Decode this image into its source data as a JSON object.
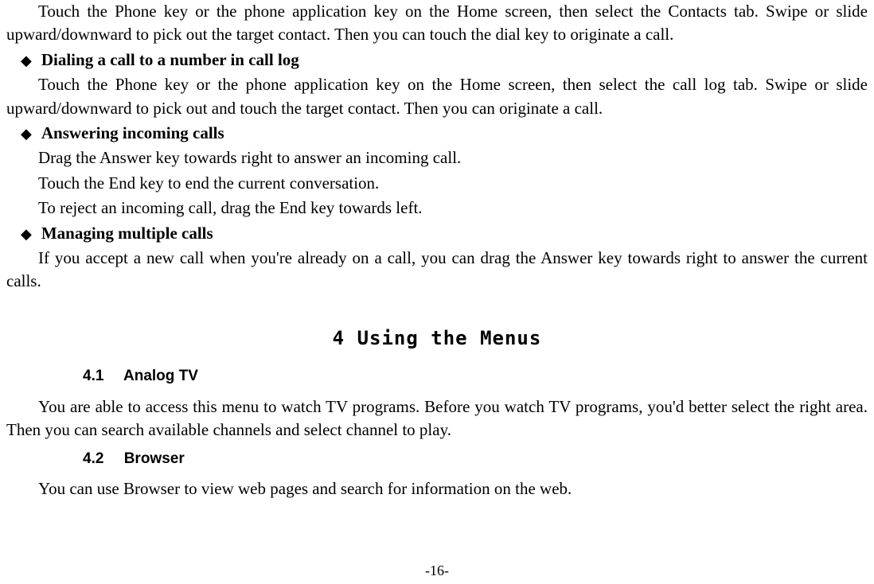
{
  "p1": "Touch the Phone key or the phone application key on the Home screen, then select the Contacts tab. Swipe or slide upward/downward to pick out the target contact. Then you can touch the dial key to originate a call.",
  "bullet1": "Dialing a call to a number in call log",
  "p2": "Touch the Phone key or the phone application key on the Home screen, then select the call log tab. Swipe or slide upward/downward to pick out and touch the target contact. Then you can originate a call.",
  "bullet2": "Answering incoming calls",
  "p3": "Drag the Answer key towards right to answer an incoming call.",
  "p4": "Touch the End key to end the current conversation.",
  "p5": "To reject an incoming call, drag the End key towards left.",
  "bullet3": "Managing multiple calls",
  "p6": "If you accept a new call when you're already on a call, you can drag the Answer key towards right to answer the current calls.",
  "sectionTitle": "4 Using the Menus",
  "sub41num": "4.1",
  "sub41": "Analog TV",
  "p7": "You are able to access this menu to watch TV programs. Before you watch TV programs, you'd better select the right area. Then you can search available channels and select channel to play.",
  "sub42num": "4.2",
  "sub42": "Browser",
  "p8": "You can use Browser to view web pages and search for information on the web.",
  "pageNum": "-16-"
}
